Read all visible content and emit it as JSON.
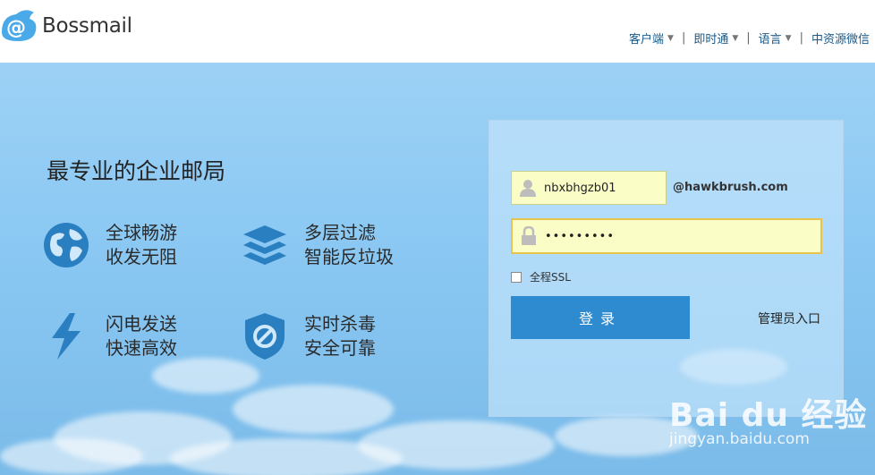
{
  "brand": {
    "name": "Bossmail",
    "logo": "bossmail-logo"
  },
  "topnav": [
    {
      "label": "客户端",
      "has_dropdown": true
    },
    {
      "label": "即时通",
      "has_dropdown": true
    },
    {
      "label": "语言",
      "has_dropdown": true
    },
    {
      "label": "中资源微信",
      "has_dropdown": false
    }
  ],
  "hero": {
    "slogan": "最专业的企业邮局",
    "features": [
      {
        "icon": "globe-icon",
        "line1": "全球畅游",
        "line2": "收发无阻"
      },
      {
        "icon": "layers-icon",
        "line1": "多层过滤",
        "line2": "智能反垃圾"
      },
      {
        "icon": "lightning-icon",
        "line1": "闪电发送",
        "line2": "快速高效"
      },
      {
        "icon": "shield-icon",
        "line1": "实时杀毒",
        "line2": "安全可靠"
      }
    ]
  },
  "login": {
    "username_value": "nbxbhgzb01",
    "domain": "@hawkbrush.com",
    "password_mask": "•••••••••",
    "ssl_label": "全程SSL",
    "ssl_checked": false,
    "login_label": "登录",
    "admin_label": "管理员入口"
  },
  "watermark": {
    "text": "Bai du 经验",
    "url": "jingyan.baidu.com"
  },
  "colors": {
    "accent": "#2e8bcf",
    "nav_link": "#1a5a8a",
    "field_bg": "#fbfdc6",
    "sky": "#8ac8f3"
  }
}
